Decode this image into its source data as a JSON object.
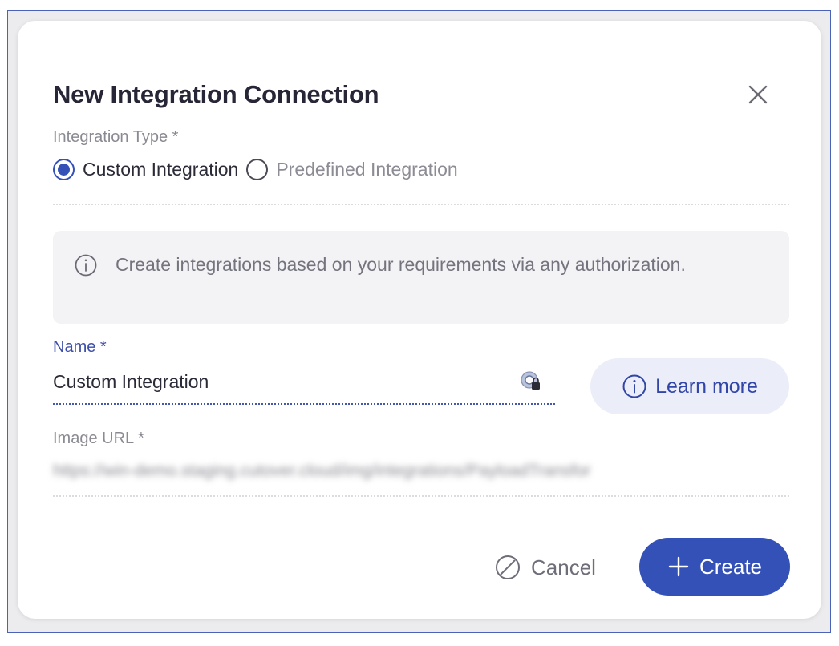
{
  "dialog": {
    "title": "New Integration Connection",
    "close_icon": "close-icon"
  },
  "integration_type": {
    "label": "Integration Type *",
    "options": [
      {
        "label": "Custom Integration",
        "checked": true
      },
      {
        "label": "Predefined Integration",
        "checked": false
      }
    ]
  },
  "info": {
    "icon": "info-icon",
    "text": "Create integrations based on your requirements via any authorization."
  },
  "name_field": {
    "label": "Name *",
    "value": "Custom Integration",
    "trailing_icon": "password-manager-lock-icon"
  },
  "learn_more": {
    "icon": "info-icon",
    "label": "Learn more"
  },
  "image_url_field": {
    "label": "Image URL *",
    "value": "https://win-demo.staging.cutover.cloud/img/integrations/PayloadTransfor"
  },
  "footer": {
    "cancel_icon": "cancel-icon",
    "cancel_label": "Cancel",
    "create_icon": "plus-icon",
    "create_label": "Create"
  },
  "colors": {
    "primary": "#3451b8",
    "frame_border": "#4a63b8",
    "learn_more_bg": "#ebeef9"
  }
}
